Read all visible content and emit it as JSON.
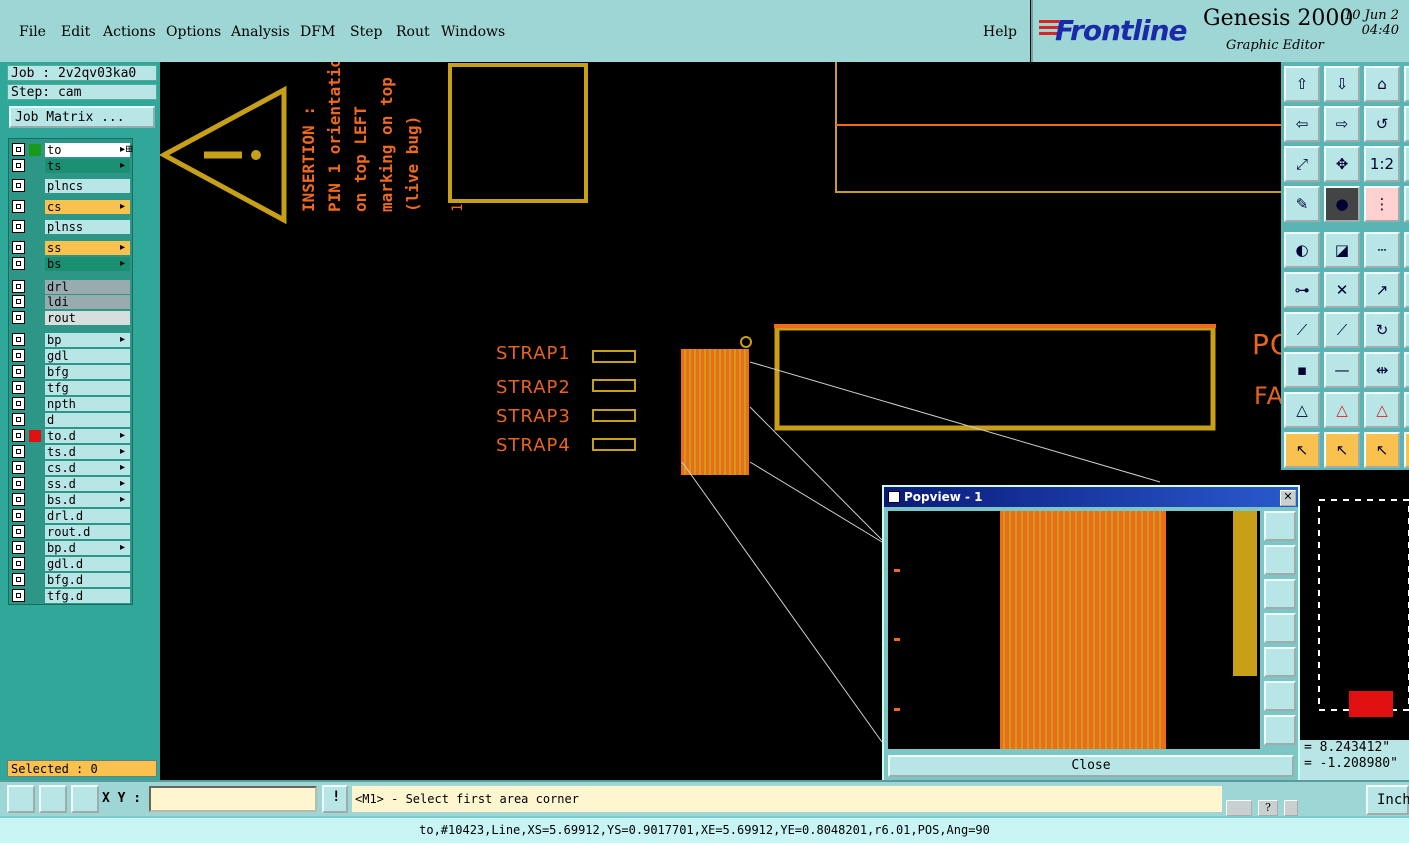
{
  "menu": {
    "items": [
      "File",
      "Edit",
      "Actions",
      "Options",
      "Analysis",
      "DFM",
      "Step",
      "Rout",
      "Windows"
    ],
    "help": "Help"
  },
  "brand": {
    "logo": "Frontline",
    "product": "Genesis 2000",
    "subtitle": "Graphic Editor",
    "date_line1": "10 Jun 2",
    "date_line2": "04:40"
  },
  "job": {
    "job_label": "Job : 2v2qv03ka0",
    "step_label": "Step: cam",
    "job_matrix": "Job Matrix ..."
  },
  "layers": [
    {
      "name": "to",
      "color": "#ffffff",
      "edit": "▸⊞",
      "active": true
    },
    {
      "name": "ts",
      "color": "#1a8f72",
      "edit": "▸"
    },
    {
      "name": "plncs",
      "color": "#b8e6e6",
      "edit": ""
    },
    {
      "name": "cs",
      "color": "#f9c24f",
      "edit": "▸"
    },
    {
      "name": "plnss",
      "color": "#b8e6e6",
      "edit": ""
    },
    {
      "name": "ss",
      "color": "#f9c24f",
      "edit": "▸"
    },
    {
      "name": "bs",
      "color": "#1a8f72",
      "edit": "▸"
    },
    {
      "name": "drl",
      "color": "#9aabb0",
      "edit": ""
    },
    {
      "name": "ldi",
      "color": "#9aabb0",
      "edit": ""
    },
    {
      "name": "rout",
      "color": "#d6dede",
      "edit": ""
    },
    {
      "name": "bp",
      "color": "#b8e6e6",
      "edit": "▸"
    },
    {
      "name": "gdl",
      "color": "#b8e6e6",
      "edit": ""
    },
    {
      "name": "bfg",
      "color": "#b8e6e6",
      "edit": ""
    },
    {
      "name": "tfg",
      "color": "#b8e6e6",
      "edit": ""
    },
    {
      "name": "npth",
      "color": "#b8e6e6",
      "edit": ""
    },
    {
      "name": "d",
      "color": "#b8e6e6",
      "edit": ""
    },
    {
      "name": "to.d",
      "color": "#b8e6e6",
      "edit": "▸",
      "marker": "#e01010"
    },
    {
      "name": "ts.d",
      "color": "#b8e6e6",
      "edit": "▸"
    },
    {
      "name": "cs.d",
      "color": "#b8e6e6",
      "edit": "▸"
    },
    {
      "name": "ss.d",
      "color": "#b8e6e6",
      "edit": "▸"
    },
    {
      "name": "bs.d",
      "color": "#b8e6e6",
      "edit": "▸"
    },
    {
      "name": "drl.d",
      "color": "#b8e6e6",
      "edit": ""
    },
    {
      "name": "rout.d",
      "color": "#b8e6e6",
      "edit": ""
    },
    {
      "name": "bp.d",
      "color": "#b8e6e6",
      "edit": "▸"
    },
    {
      "name": "gdl.d",
      "color": "#b8e6e6",
      "edit": ""
    },
    {
      "name": "bfg.d",
      "color": "#b8e6e6",
      "edit": ""
    },
    {
      "name": "tfg.d",
      "color": "#b8e6e6",
      "edit": ""
    }
  ],
  "selected": "Selected : 0",
  "canvas": {
    "note_lines": [
      "INSERTION :",
      "PIN 1 orientatio",
      "on top LEFT",
      "marking on top",
      "(live bug)"
    ],
    "straps": [
      "STRAP1",
      "STRAP2",
      "STRAP3",
      "STRAP4"
    ],
    "edge_text_1": "PC",
    "edge_text_2": "FA",
    "pin_mark": "1"
  },
  "popview": {
    "title": "Popview - 1",
    "close_label": "Close"
  },
  "coords": {
    "x": "= 8.243412\"",
    "y": "= -1.208980\""
  },
  "cmd": {
    "xy_label": "X Y :",
    "xy_value": "",
    "prompt": "<M1> - Select first area corner",
    "units": "Inch"
  },
  "status": "to,#10423,Line,XS=5.69912,YS=0.9017701,XE=5.69912,YE=0.8048201,r6.01,POS,Ang=90",
  "colors": {
    "accent_panel": "#9ed6d6",
    "cad_orange": "#f06a1e",
    "cad_gold": "#c8a018"
  }
}
